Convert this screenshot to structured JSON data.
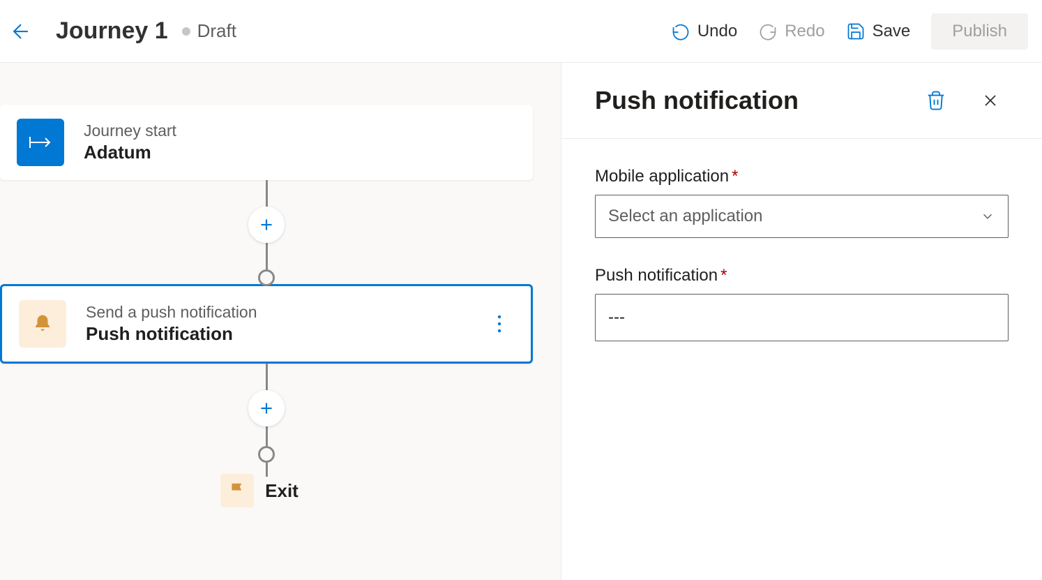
{
  "header": {
    "title": "Journey 1",
    "status": "Draft",
    "actions": {
      "undo": "Undo",
      "redo": "Redo",
      "save": "Save",
      "publish": "Publish"
    }
  },
  "canvas": {
    "start": {
      "subtitle": "Journey start",
      "title": "Adatum"
    },
    "push": {
      "subtitle": "Send a push notification",
      "title": "Push notification"
    },
    "exit": "Exit"
  },
  "panel": {
    "title": "Push notification",
    "fields": {
      "mobile_app": {
        "label": "Mobile application",
        "placeholder": "Select an application"
      },
      "push_notification": {
        "label": "Push notification",
        "value": "---"
      }
    }
  }
}
